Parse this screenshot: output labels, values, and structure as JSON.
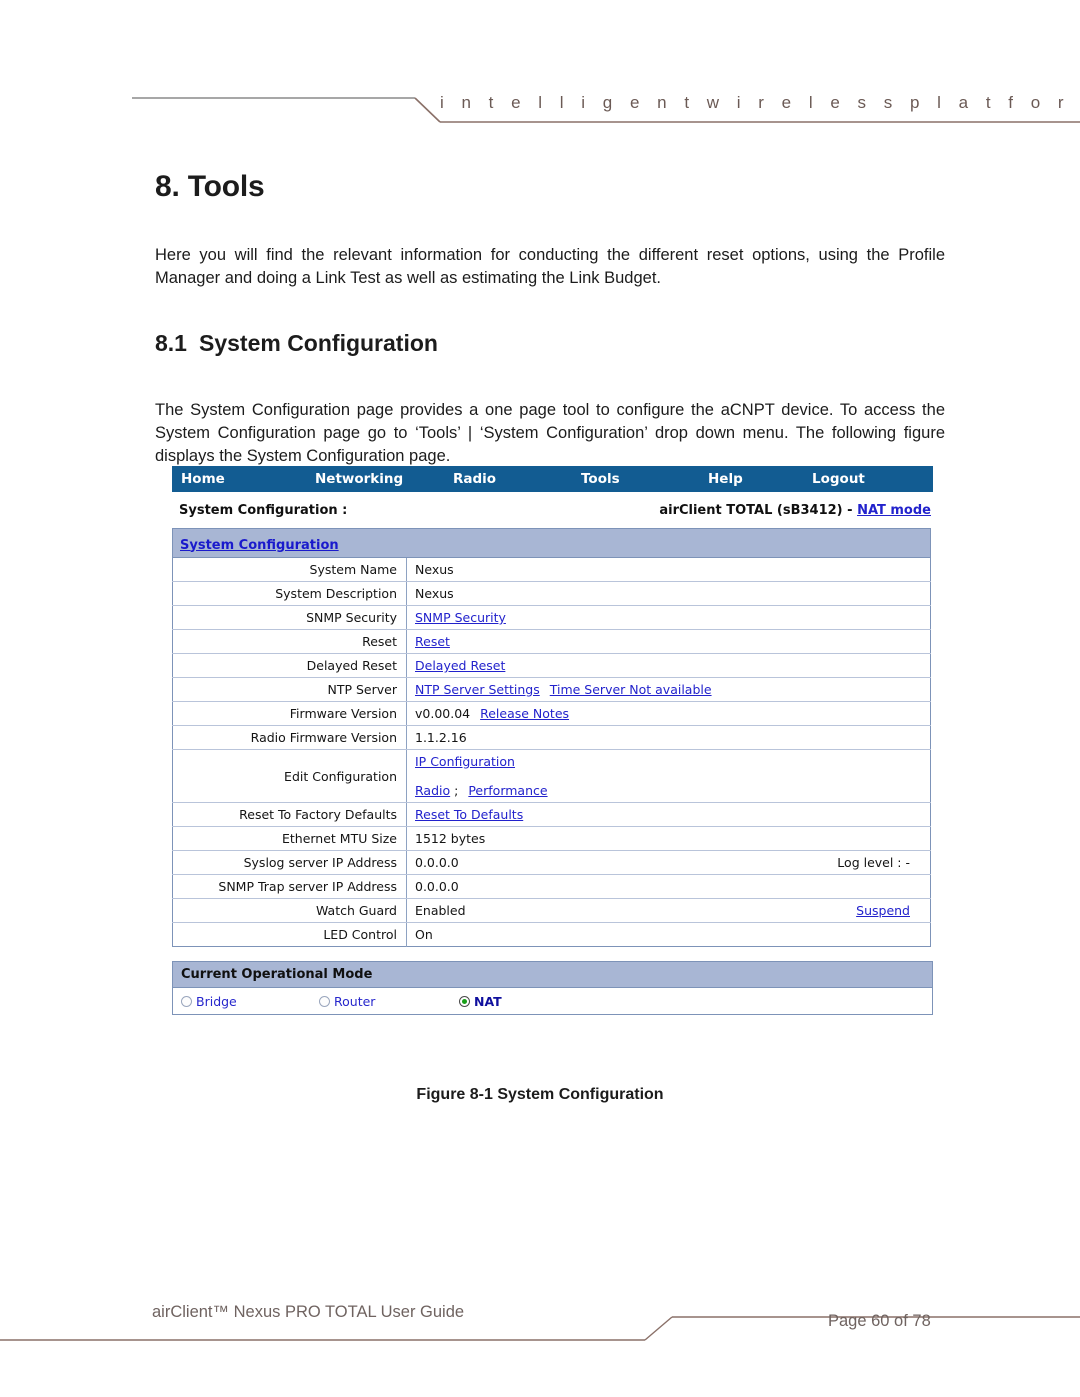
{
  "header": {
    "tagline": "i n t e l l i g e n t      w i r e l e s s      p l a t f o r m"
  },
  "document": {
    "chapter_title": "8. Tools",
    "intro_paragraph": "Here you will find the relevant information for conducting the different reset options, using the Profile Manager and doing a Link Test as well as estimating the Link Budget.",
    "section_number": "8.1",
    "section_title": "System Configuration",
    "section_paragraph": "The System Configuration page provides a one page tool to configure the aCNPT device. To access the System Configuration page go to ‘Tools’ | ‘System Configuration’ drop down menu. The following figure displays the System Configuration page.",
    "figure_caption": "Figure 8-1 System Configuration"
  },
  "webui": {
    "nav": [
      {
        "label": "Home"
      },
      {
        "label": "Networking"
      },
      {
        "label": "Radio"
      },
      {
        "label": "Tools"
      },
      {
        "label": "Help"
      },
      {
        "label": "Logout"
      }
    ],
    "title_bar": {
      "left": "System Configuration :",
      "device": "airClient TOTAL (sB3412) -",
      "mode_link": "NAT mode"
    },
    "table_header": "System Configuration",
    "rows": [
      {
        "label": "System Name",
        "value": "Nexus"
      },
      {
        "label": "System Description",
        "value": "Nexus"
      },
      {
        "label": "SNMP Security",
        "link": "SNMP Security"
      },
      {
        "label": "Reset",
        "link": "Reset"
      },
      {
        "label": "Delayed Reset",
        "link": "Delayed Reset"
      },
      {
        "label": "NTP Server",
        "link": "NTP Server Settings",
        "link2": "Time Server Not available"
      },
      {
        "label": "Firmware Version",
        "value": "v0.00.04",
        "link": "Release Notes"
      },
      {
        "label": "Radio Firmware Version",
        "value": "1.1.2.16"
      },
      {
        "label": "Edit Configuration",
        "link": "IP Configuration",
        "link2": "Radio",
        "separator": ";",
        "link3": "Performance"
      },
      {
        "label": "Reset To Factory Defaults",
        "link": "Reset To Defaults"
      },
      {
        "label": "Ethernet MTU Size",
        "value": "1512 bytes"
      },
      {
        "label": "Syslog server IP Address",
        "value": "0.0.0.0",
        "right": "Log level : -"
      },
      {
        "label": "SNMP Trap server IP Address",
        "value": "0.0.0.0"
      },
      {
        "label": "Watch Guard",
        "value": "Enabled",
        "right_link": "Suspend"
      },
      {
        "label": "LED Control",
        "value": "On"
      }
    ],
    "operational_mode": {
      "title": "Current Operational Mode",
      "options": [
        {
          "label": "Bridge",
          "selected": false
        },
        {
          "label": "Router",
          "selected": false
        },
        {
          "label": "NAT",
          "selected": true
        }
      ]
    }
  },
  "footer": {
    "left": "airClient™ Nexus PRO TOTAL User Guide",
    "right": "Page 60 of 78"
  },
  "colors": {
    "nav_blue": "#125c92",
    "header_row_blue": "#a8b6d4",
    "link_blue": "#2222cc",
    "selected_radio_green": "#18a018",
    "rule_brown": "#8a7068",
    "rule_gray": "#8a8a8a"
  }
}
